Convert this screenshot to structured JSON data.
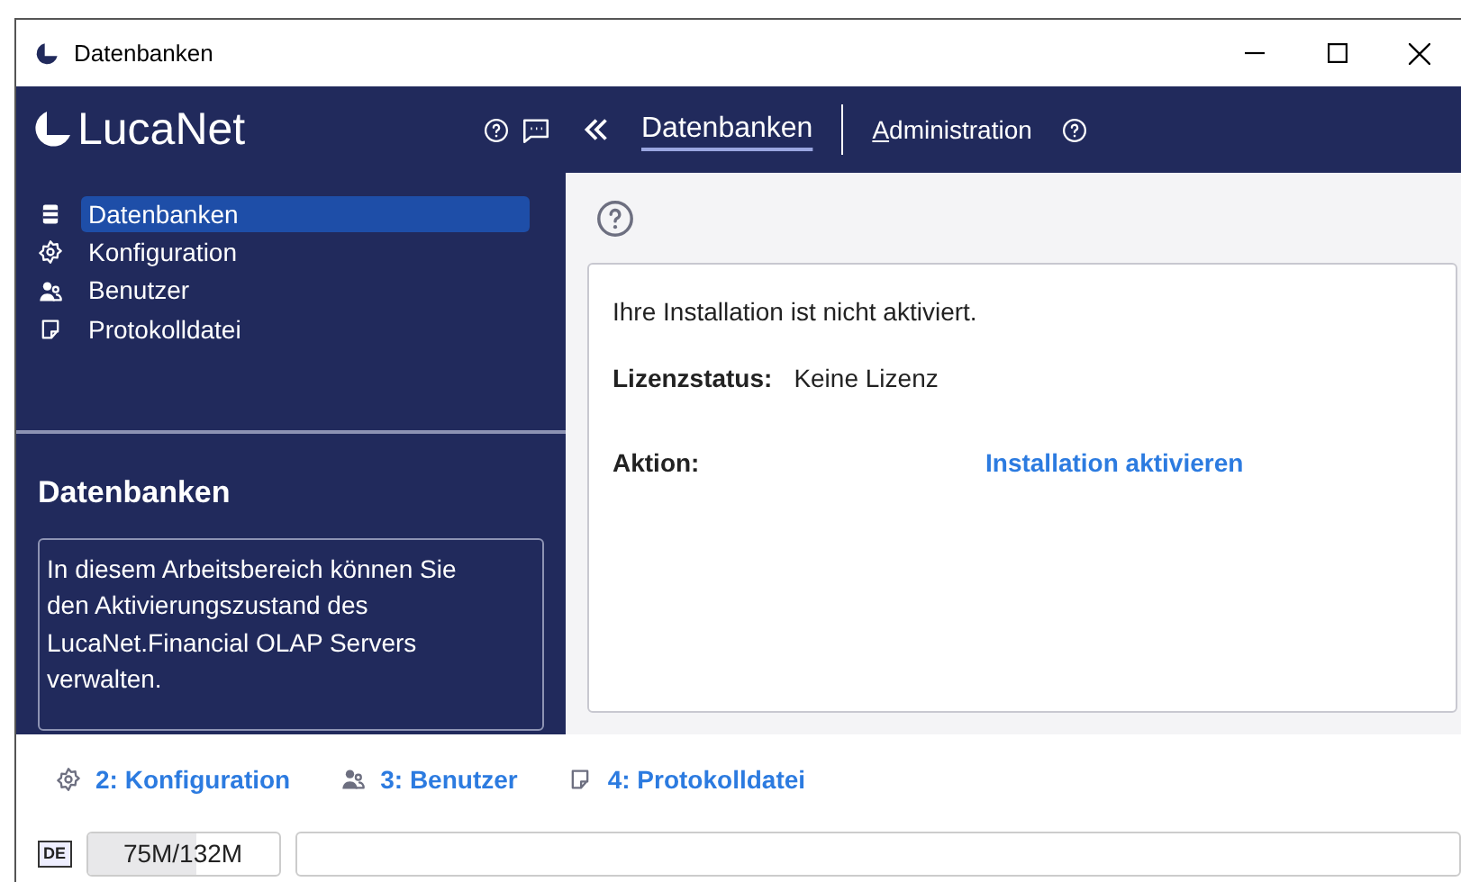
{
  "window": {
    "title": "Datenbanken"
  },
  "header": {
    "logo": "LucaNet",
    "breadcrumbs": [
      {
        "label": "Datenbanken",
        "selected": true
      },
      {
        "label": "Administration",
        "selected": false
      }
    ]
  },
  "sidebar": {
    "items": [
      {
        "label": "Datenbanken",
        "kind": "database",
        "selected": true
      },
      {
        "label": "Konfiguration",
        "kind": "gear",
        "selected": false
      },
      {
        "label": "Benutzer",
        "kind": "users",
        "selected": false
      },
      {
        "label": "Protokolldatei",
        "kind": "note",
        "selected": false
      }
    ],
    "info": {
      "title": "Datenbanken",
      "text": "In diesem Arbeitsbereich können Sie den Aktivierungszustand des LucaNet.Financial OLAP Servers verwalten."
    }
  },
  "content": {
    "message": "Ihre Installation ist nicht aktiviert.",
    "status_label": "Lizenzstatus:",
    "status_value": "Keine Lizenz",
    "action_label": "Aktion:",
    "action_link": "Installation aktivieren"
  },
  "shortcuts": [
    {
      "label": "2: Konfiguration",
      "kind": "gear"
    },
    {
      "label": "3: Benutzer",
      "kind": "users"
    },
    {
      "label": "4: Protokolldatei",
      "kind": "note"
    }
  ],
  "status_bar": {
    "language": "DE",
    "memory": {
      "reading": "75M/132M",
      "level": 0.57
    }
  }
}
